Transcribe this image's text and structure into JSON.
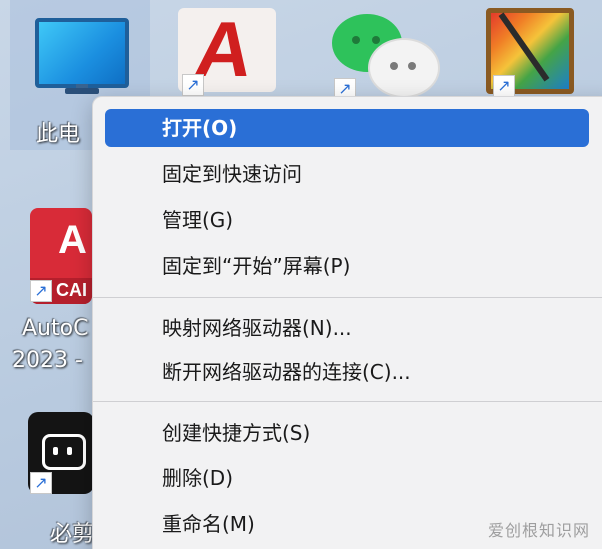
{
  "desktop": {
    "icons": {
      "this_pc": {
        "label": "此电",
        "icon": "monitor-icon"
      },
      "autocad_top": {
        "glyph": "A",
        "icon": "autocad-icon"
      },
      "wechat": {
        "icon": "wechat-icon"
      },
      "paint": {
        "icon": "paint-icon"
      },
      "autocad_left": {
        "glyph": "A",
        "band": "CAI",
        "label_line1": "AutoC",
        "label_line2": "2023 -",
        "icon": "autocad-icon"
      },
      "bilibili": {
        "label": "必剪",
        "icon": "bilibili-icon"
      }
    },
    "shortcut_arrow": "↗"
  },
  "context_menu": {
    "groups": [
      {
        "items": [
          {
            "label": "打开(O)",
            "highlighted": true
          },
          {
            "label": "固定到快速访问",
            "highlighted": false
          },
          {
            "label": "管理(G)",
            "highlighted": false
          },
          {
            "label": "固定到“开始”屏幕(P)",
            "highlighted": false
          }
        ]
      },
      {
        "items": [
          {
            "label": "映射网络驱动器(N)...",
            "highlighted": false
          },
          {
            "label": "断开网络驱动器的连接(C)...",
            "highlighted": false
          }
        ]
      },
      {
        "items": [
          {
            "label": "创建快捷方式(S)",
            "highlighted": false
          },
          {
            "label": "删除(D)",
            "highlighted": false
          },
          {
            "label": "重命名(M)",
            "highlighted": false
          }
        ]
      }
    ]
  },
  "colors": {
    "highlight": "#2a6fd6",
    "menu_background": "#f2f2f3",
    "desktop_background": "#bfcfe2"
  },
  "watermark": "爱创根知识网"
}
